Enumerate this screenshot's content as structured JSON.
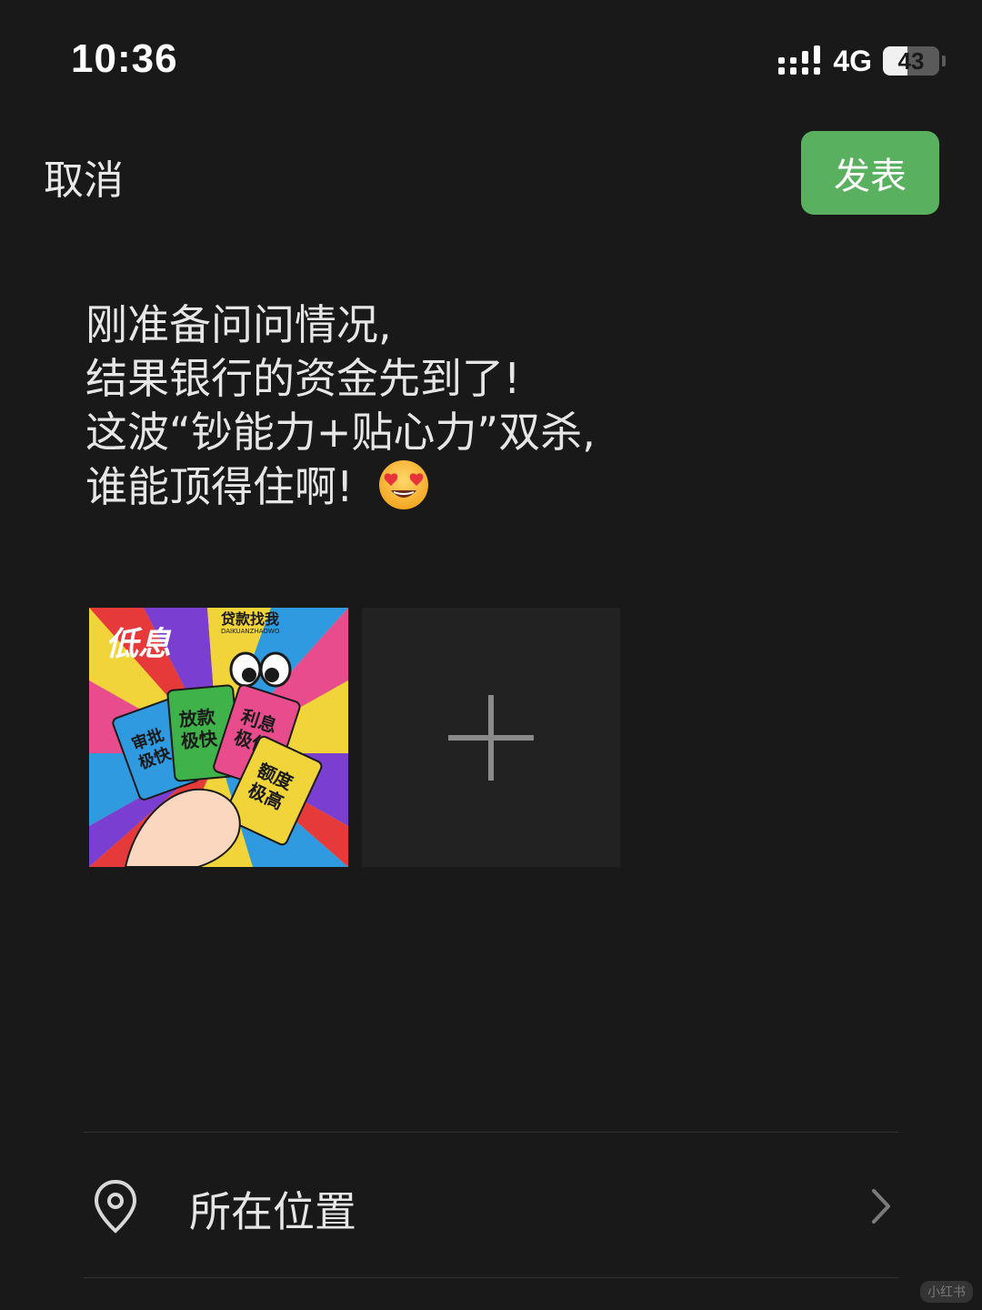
{
  "status_bar": {
    "time": "10:36",
    "network": "4G",
    "battery": "43",
    "battery_level": 0.43
  },
  "header": {
    "cancel_label": "取消",
    "publish_label": "发表"
  },
  "post": {
    "lines": [
      "刚准备问问情况,",
      "结果银行的资金先到了!",
      "这波“钞能力+贴心力”双杀,",
      "谁能顶得住啊!"
    ],
    "emoji": "smiling-face-with-heart-eyes"
  },
  "images": {
    "thumbnail": {
      "texts": [
        "低息",
        "贷款找我",
        "DAIKUANZHAOWO",
        "放款",
        "极快",
        "利息",
        "极低",
        "额度",
        "极高",
        "审批",
        "极快"
      ]
    },
    "add_icon": "plus-icon"
  },
  "location": {
    "label": "所在位置",
    "icon": "location-pin-icon",
    "chevron_icon": "chevron-right-icon"
  },
  "watermark": "小红书"
}
